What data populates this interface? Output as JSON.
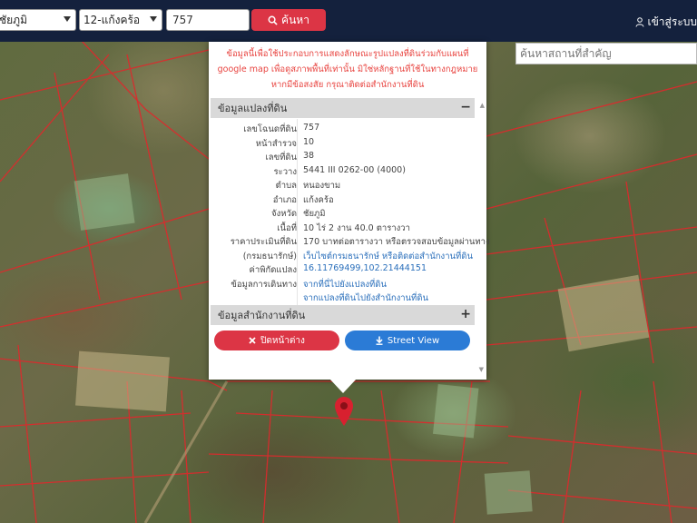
{
  "topbar": {
    "province_select": "ชัยภูมิ",
    "district_select": "12-แก้งคร้อ",
    "parcel_input": "757",
    "search_label": "ค้นหา",
    "login_label": "เข้าสู่ระบบ"
  },
  "place_search": {
    "placeholder": "ค้นหาสถานที่สำคัญ"
  },
  "popup": {
    "disclaimer": "ข้อมูลนี้เพื่อใช้ประกอบการแสดงลักษณะรูปแปลงที่ดินร่วมกับแผนที่ google map เพื่อดูสภาพพื้นที่เท่านั้น มิใช่หลักฐานที่ใช้ในทางกฎหมาย หากมีข้อสงสัย กรุณาติดต่อสำนักงานที่ดิน",
    "parcel_section": {
      "title": "ข้อมูลแปลงที่ดิน",
      "toggle": "−"
    },
    "rows": [
      {
        "label": "เลขโฉนดที่ดิน",
        "value": "757",
        "link": false
      },
      {
        "label": "หน้าสำรวจ",
        "value": "10",
        "link": false
      },
      {
        "label": "เลขที่ดิน",
        "value": "38",
        "link": false
      },
      {
        "label": "ระวาง",
        "value": "5441 III 0262-00 (4000)",
        "link": false
      },
      {
        "label": "ตำบล",
        "value": "หนองขาม",
        "link": false
      },
      {
        "label": "อำเภอ",
        "value": "แก้งคร้อ",
        "link": false
      },
      {
        "label": "จังหวัด",
        "value": "ชัยภูมิ",
        "link": false
      },
      {
        "label": "เนื้อที่",
        "value": "10 ไร่ 2 งาน 40.0 ตารางวา",
        "link": false
      },
      {
        "label": "ราคาประเมินที่ดิน",
        "value": "170 บาทต่อตารางวา หรือตรวจสอบข้อมูลผ่านทาง",
        "link": false
      },
      {
        "label": "(กรมธนารักษ์)",
        "value": "เว็บไซต์กรมธนารักษ์ หรือติดต่อสำนักงานที่ดิน",
        "link": true
      },
      {
        "label": "ค่าพิกัดแปลง",
        "value": "16.11769499,102.21444151",
        "link": true
      },
      {
        "label": "ข้อมูลการเดินทาง",
        "value": "จากที่นี่ไปยังแปลงที่ดิน",
        "link": true
      },
      {
        "label": "",
        "value": "จากแปลงที่ดินไปยังสำนักงานที่ดิน",
        "link": true
      }
    ],
    "office_section": {
      "title": "ข้อมูลสำนักงานที่ดิน",
      "toggle": "+"
    },
    "close_button": "ปิดหน้าต่าง",
    "streetview_button": "Street View"
  },
  "colors": {
    "topbar": "#14213d",
    "accent_red": "#dc3545",
    "accent_blue": "#2b7bd6",
    "link": "#2a6fbb",
    "pin": "#d8202f"
  },
  "icons": [
    "search-icon",
    "user-icon",
    "close-x-icon",
    "download-icon",
    "map-pin-icon"
  ]
}
